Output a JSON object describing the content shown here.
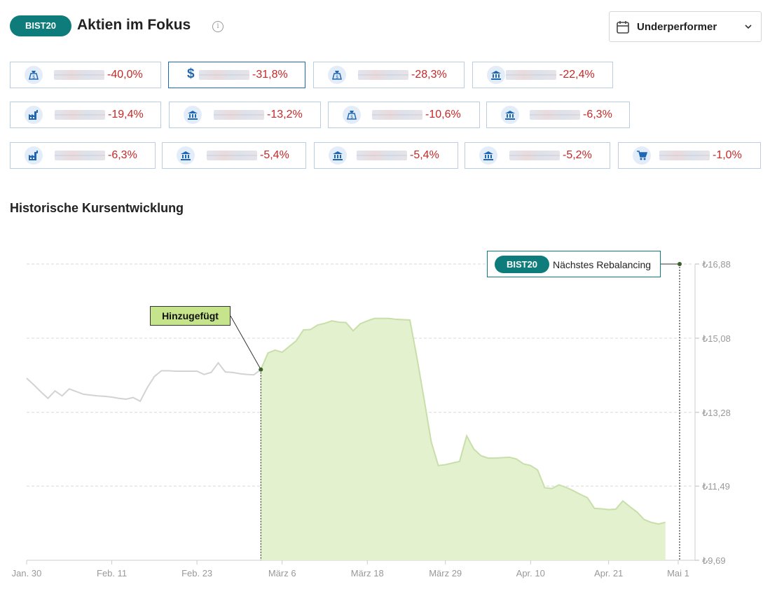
{
  "header": {
    "badge": "BIST20",
    "title": "Aktien im Fokus",
    "info_icon": "info-icon",
    "dropdown": {
      "icon": "calendar-icon",
      "value": "Underperformer",
      "chevron": "chevron-down-icon"
    }
  },
  "chips": [
    {
      "icon": "bag-icon",
      "value": "-40,0%"
    },
    {
      "icon": "dollar-icon",
      "value": "-31,8%",
      "selected": true
    },
    {
      "icon": "bag-icon",
      "value": "-28,3%"
    },
    {
      "icon": "bank-icon",
      "value": "-22,4%"
    },
    {
      "icon": "factory-icon",
      "value": "-19,4%"
    },
    {
      "icon": "bank-icon",
      "value": "-13,2%"
    },
    {
      "icon": "bag-icon",
      "value": "-10,6%"
    },
    {
      "icon": "bank-icon",
      "value": "-6,3%"
    },
    {
      "icon": "factory-icon",
      "value": "-6,3%"
    },
    {
      "icon": "bank-icon",
      "value": "-5,4%"
    },
    {
      "icon": "bank-icon",
      "value": "-5,4%"
    },
    {
      "icon": "bank-icon",
      "value": "-5,2%"
    },
    {
      "icon": "cart-icon",
      "value": "-1,0%"
    }
  ],
  "section": {
    "title": "Historische Kursentwicklung"
  },
  "annotations": {
    "added": "Hinzugefügt",
    "rebalancing_badge": "BIST20",
    "rebalancing_text": "Nächstes Rebalancing"
  },
  "colors": {
    "accent": "#0e7c7b",
    "negative": "#c62828",
    "area_fill": "#e2f0cc",
    "area_line": "#c8dfa9",
    "line_before": "#d3d3d3",
    "icon_blue": "#1f66b3"
  },
  "chart_data": {
    "type": "area",
    "title": "",
    "xlabel": "",
    "ylabel": "",
    "currency": "₺",
    "y_ticks": [
      "₺9,69",
      "₺11,49",
      "₺13,28",
      "₺15,08",
      "₺16,88"
    ],
    "ylim": [
      9.69,
      16.88
    ],
    "x_ticks": [
      "Jan. 30",
      "Feb. 11",
      "Feb. 23",
      "März 6",
      "März 18",
      "März 29",
      "Apr. 10",
      "Apr. 21",
      "Mai 1"
    ],
    "grid": true,
    "added_on": "2024-03-03",
    "next_rebalancing": "2024-05-01",
    "series": [
      {
        "x": [
          "2024-01-30",
          "2024-01-31",
          "2024-02-01",
          "2024-02-02",
          "2024-02-03",
          "2024-02-04",
          "2024-02-05",
          "2024-02-07",
          "2024-02-08",
          "2024-02-09",
          "2024-02-10",
          "2024-02-11",
          "2024-02-12",
          "2024-02-13",
          "2024-02-14",
          "2024-02-15",
          "2024-02-16",
          "2024-02-17",
          "2024-02-18",
          "2024-02-19",
          "2024-02-20",
          "2024-02-21",
          "2024-02-22",
          "2024-02-23",
          "2024-02-24",
          "2024-02-25",
          "2024-02-26",
          "2024-02-27",
          "2024-02-28",
          "2024-02-29",
          "2024-03-01",
          "2024-03-02",
          "2024-03-03",
          "2024-03-04",
          "2024-03-05",
          "2024-03-06",
          "2024-03-07",
          "2024-03-08",
          "2024-03-09",
          "2024-03-10",
          "2024-03-11",
          "2024-03-12",
          "2024-03-13",
          "2024-03-14",
          "2024-03-15",
          "2024-03-16",
          "2024-03-17",
          "2024-03-18",
          "2024-03-19",
          "2024-03-20",
          "2024-03-21",
          "2024-03-22",
          "2024-03-23",
          "2024-03-24",
          "2024-03-25",
          "2024-03-26",
          "2024-03-27",
          "2024-03-28",
          "2024-03-29",
          "2024-03-30",
          "2024-03-31",
          "2024-04-01",
          "2024-04-02",
          "2024-04-03",
          "2024-04-04",
          "2024-04-05",
          "2024-04-06",
          "2024-04-07",
          "2024-04-08",
          "2024-04-09",
          "2024-04-10",
          "2024-04-11",
          "2024-04-12",
          "2024-04-13",
          "2024-04-14",
          "2024-04-15",
          "2024-04-16",
          "2024-04-17",
          "2024-04-18",
          "2024-04-19",
          "2024-04-20",
          "2024-04-21",
          "2024-04-22",
          "2024-04-23",
          "2024-04-24",
          "2024-04-25",
          "2024-04-26",
          "2024-04-27",
          "2024-04-28",
          "2024-04-29"
        ],
        "y": [
          14.11,
          13.95,
          13.78,
          13.62,
          13.8,
          13.68,
          13.85,
          13.72,
          13.7,
          13.68,
          13.67,
          13.65,
          13.62,
          13.6,
          13.64,
          13.55,
          13.88,
          14.15,
          14.29,
          14.29,
          14.28,
          14.28,
          14.28,
          14.28,
          14.2,
          14.25,
          14.48,
          14.26,
          14.25,
          14.22,
          14.2,
          14.19,
          14.32,
          14.72,
          14.79,
          14.74,
          14.88,
          15.02,
          15.28,
          15.29,
          15.4,
          15.44,
          15.5,
          15.47,
          15.46,
          15.26,
          15.43,
          15.5,
          15.56,
          15.56,
          15.56,
          15.54,
          15.53,
          15.52,
          14.6,
          13.6,
          12.57,
          11.99,
          12.01,
          12.05,
          12.09,
          12.71,
          12.39,
          12.23,
          12.17,
          12.17,
          12.18,
          12.19,
          12.15,
          12.03,
          11.99,
          11.88,
          11.45,
          11.43,
          11.52,
          11.46,
          11.38,
          11.29,
          11.21,
          10.95,
          10.94,
          10.92,
          10.93,
          11.13,
          10.99,
          10.86,
          10.68,
          10.61,
          10.57,
          10.61
        ]
      }
    ]
  }
}
